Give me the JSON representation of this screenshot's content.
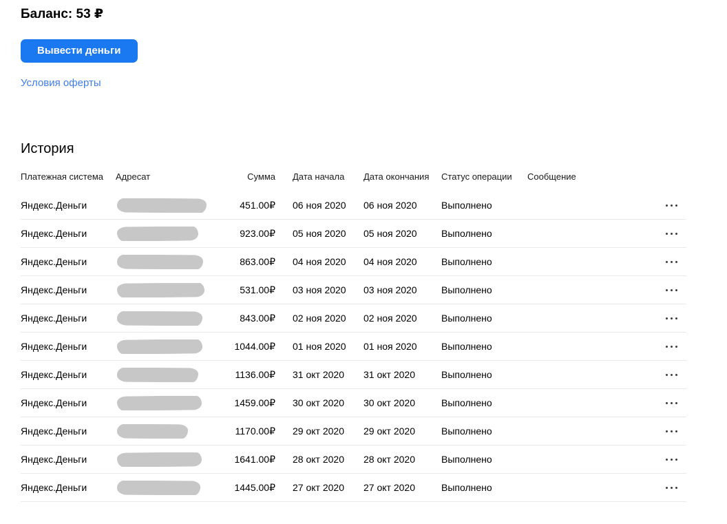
{
  "balance": {
    "text": "Баланс: 53 ₽"
  },
  "actions": {
    "withdraw_button": "Вывести деньги",
    "offer_link": "Условия оферты"
  },
  "history": {
    "title": "История",
    "columns": [
      "Платежная система",
      "Адресат",
      "Сумма",
      "Дата начала",
      "Дата окончания",
      "Статус операции",
      "Сообщение"
    ],
    "rows": [
      {
        "payment_system": "Яндекс.Деньги",
        "recipient_redacted": true,
        "redaction_width": 130,
        "amount": "451.00₽",
        "date_start": "06 ноя 2020",
        "date_end": "06 ноя 2020",
        "status": "Выполнено",
        "message": ""
      },
      {
        "payment_system": "Яндекс.Деньги",
        "recipient_redacted": true,
        "redaction_width": 118,
        "amount": "923.00₽",
        "date_start": "05 ноя 2020",
        "date_end": "05 ноя 2020",
        "status": "Выполнено",
        "message": ""
      },
      {
        "payment_system": "Яндекс.Деньги",
        "recipient_redacted": true,
        "redaction_width": 125,
        "amount": "863.00₽",
        "date_start": "04 ноя 2020",
        "date_end": "04 ноя 2020",
        "status": "Выполнено",
        "message": ""
      },
      {
        "payment_system": "Яндекс.Деньги",
        "recipient_redacted": true,
        "redaction_width": 127,
        "amount": "531.00₽",
        "date_start": "03 ноя 2020",
        "date_end": "03 ноя 2020",
        "status": "Выполнено",
        "message": ""
      },
      {
        "payment_system": "Яндекс.Деньги",
        "recipient_redacted": true,
        "redaction_width": 124,
        "amount": "843.00₽",
        "date_start": "02 ноя 2020",
        "date_end": "02 ноя 2020",
        "status": "Выполнено",
        "message": ""
      },
      {
        "payment_system": "Яндекс.Деньги",
        "recipient_redacted": true,
        "redaction_width": 124,
        "amount": "1044.00₽",
        "date_start": "01 ноя 2020",
        "date_end": "01 ноя 2020",
        "status": "Выполнено",
        "message": ""
      },
      {
        "payment_system": "Яндекс.Деньги",
        "recipient_redacted": true,
        "redaction_width": 118,
        "amount": "1136.00₽",
        "date_start": "31 окт 2020",
        "date_end": "31 окт 2020",
        "status": "Выполнено",
        "message": ""
      },
      {
        "payment_system": "Яндекс.Деньги",
        "recipient_redacted": true,
        "redaction_width": 123,
        "amount": "1459.00₽",
        "date_start": "30 окт 2020",
        "date_end": "30 окт 2020",
        "status": "Выполнено",
        "message": ""
      },
      {
        "payment_system": "Яндекс.Деньги",
        "recipient_redacted": true,
        "redaction_width": 103,
        "amount": "1170.00₽",
        "date_start": "29 окт 2020",
        "date_end": "29 окт 2020",
        "status": "Выполнено",
        "message": ""
      },
      {
        "payment_system": "Яндекс.Деньги",
        "recipient_redacted": true,
        "redaction_width": 123,
        "amount": "1641.00₽",
        "date_start": "28 окт 2020",
        "date_end": "28 окт 2020",
        "status": "Выполнено",
        "message": ""
      },
      {
        "payment_system": "Яндекс.Деньги",
        "recipient_redacted": true,
        "redaction_width": 121,
        "amount": "1445.00₽",
        "date_start": "27 окт 2020",
        "date_end": "27 окт 2020",
        "status": "Выполнено",
        "message": ""
      }
    ]
  },
  "colors": {
    "accent_blue": "#1a78f0",
    "link_blue": "#3e7de7",
    "divider": "#e8e8e8",
    "redaction_gray": "#c7c7c7"
  }
}
